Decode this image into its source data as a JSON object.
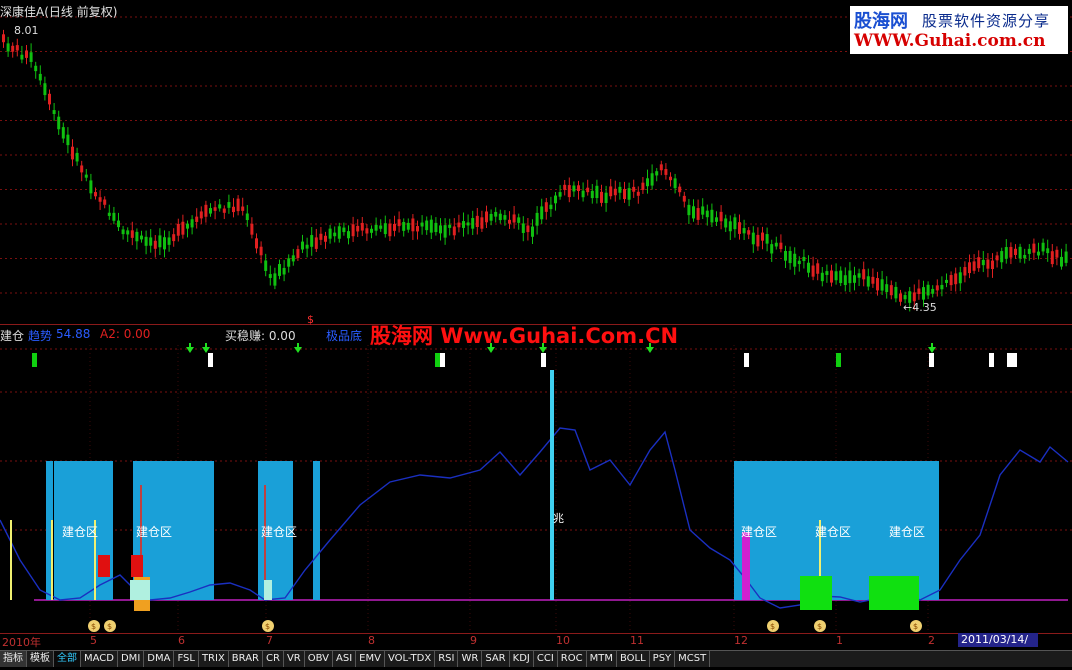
{
  "window": {
    "title": "深康佳A(日线 前复权)"
  },
  "logo": {
    "brand": "股海网",
    "slogan": "股票软件资源分享",
    "url": "WWW.Guhai.com.cn"
  },
  "price_panel": {
    "high_label": "8.01",
    "low_label": "←4.35",
    "grid_lines": 9,
    "colors": {
      "up": "#e02020",
      "down": "#10c010",
      "grid": "#7a1010"
    }
  },
  "indicator_bar": {
    "name": "建仓",
    "trend_label": "趋势",
    "trend_value": "54.88",
    "a2_label": "A2: 0.00",
    "buy_label": "买稳赚: 0.00",
    "extreme_label": "极品底"
  },
  "watermark": "股海网 Www.Guhai.Com.CN",
  "dollar_mark": "$",
  "sign_text": "兆",
  "zones": [
    {
      "label": "建仓区"
    },
    {
      "label": "建仓区"
    },
    {
      "label": "建仓区"
    },
    {
      "label": "建仓区"
    },
    {
      "label": "建仓区"
    },
    {
      "label": "建仓区"
    }
  ],
  "x_axis": {
    "labels": [
      "2010年",
      "5",
      "6",
      "7",
      "8",
      "9",
      "10",
      "11",
      "12",
      "1",
      "2"
    ],
    "current_date": "2011/03/14/—"
  },
  "tabs": [
    "指标",
    "模板",
    "全部",
    "MACD",
    "DMI",
    "DMA",
    "FSL",
    "TRIX",
    "BRAR",
    "CR",
    "VR",
    "OBV",
    "ASI",
    "EMV",
    "VOL-TDX",
    "RSI",
    "WR",
    "SAR",
    "KDJ",
    "CCI",
    "ROC",
    "MTM",
    "BOLL",
    "PSY",
    "MCST"
  ],
  "colors": {
    "zone": "#1aa0d8",
    "trend_line": "#1a2fc0",
    "baseline": "#c020c0",
    "accent_red": "#e01010",
    "accent_green": "#10e010",
    "accent_yellow": "#f0f070"
  }
}
